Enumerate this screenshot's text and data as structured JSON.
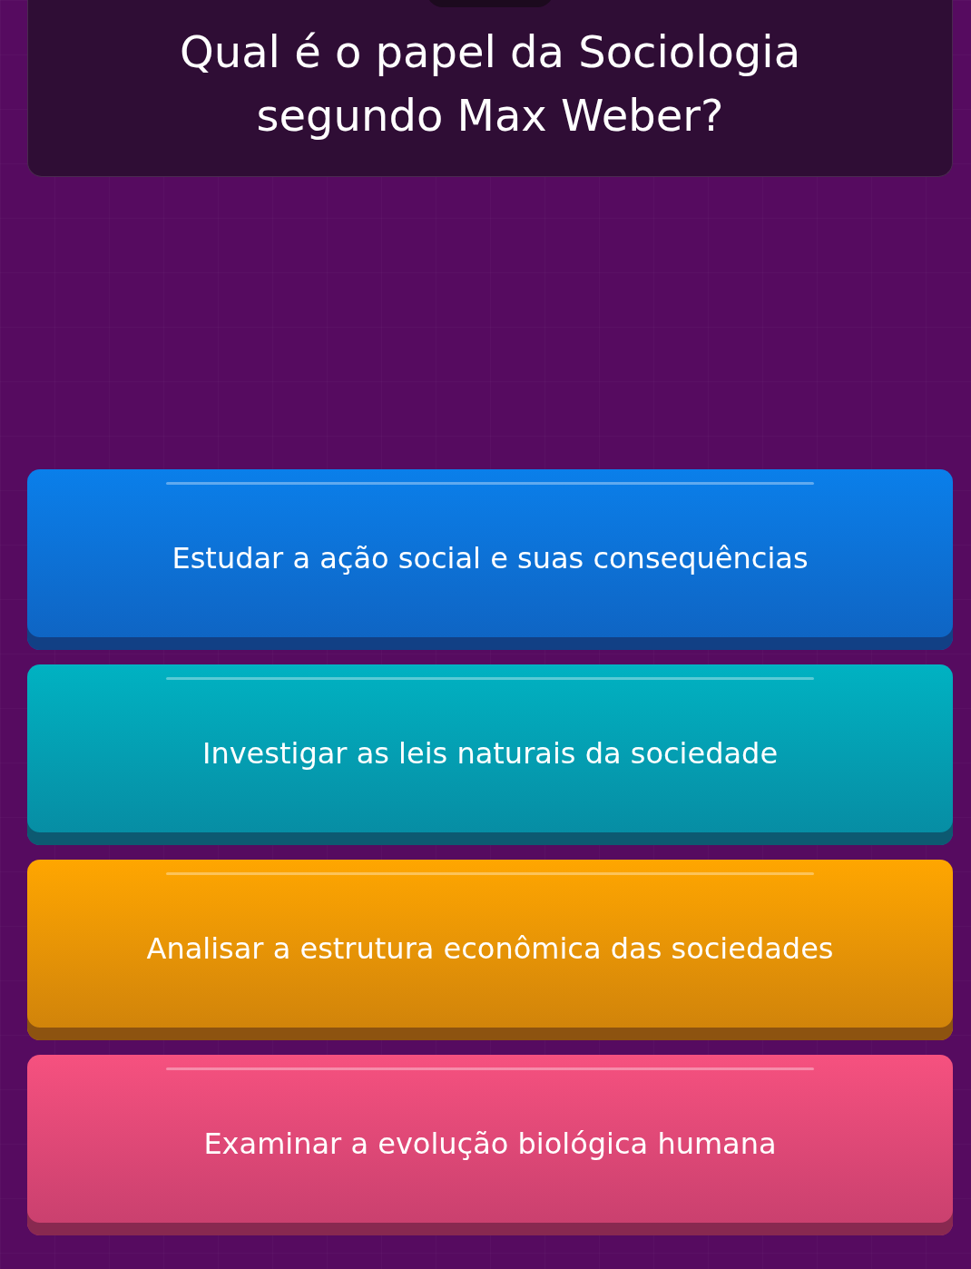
{
  "question": {
    "text": "Qual é o papel da Sociologia segundo Max Weber?"
  },
  "answers": [
    {
      "text": "Estudar a ação social e suas consequências",
      "color": "#0a7fea"
    },
    {
      "text": "Investigar as leis naturais da sociedade",
      "color": "#00b2c2"
    },
    {
      "text": "Analisar a estrutura econômica das sociedades",
      "color": "#ffa600"
    },
    {
      "text": "Examinar a evolução biológica humana",
      "color": "#f6517f"
    }
  ]
}
